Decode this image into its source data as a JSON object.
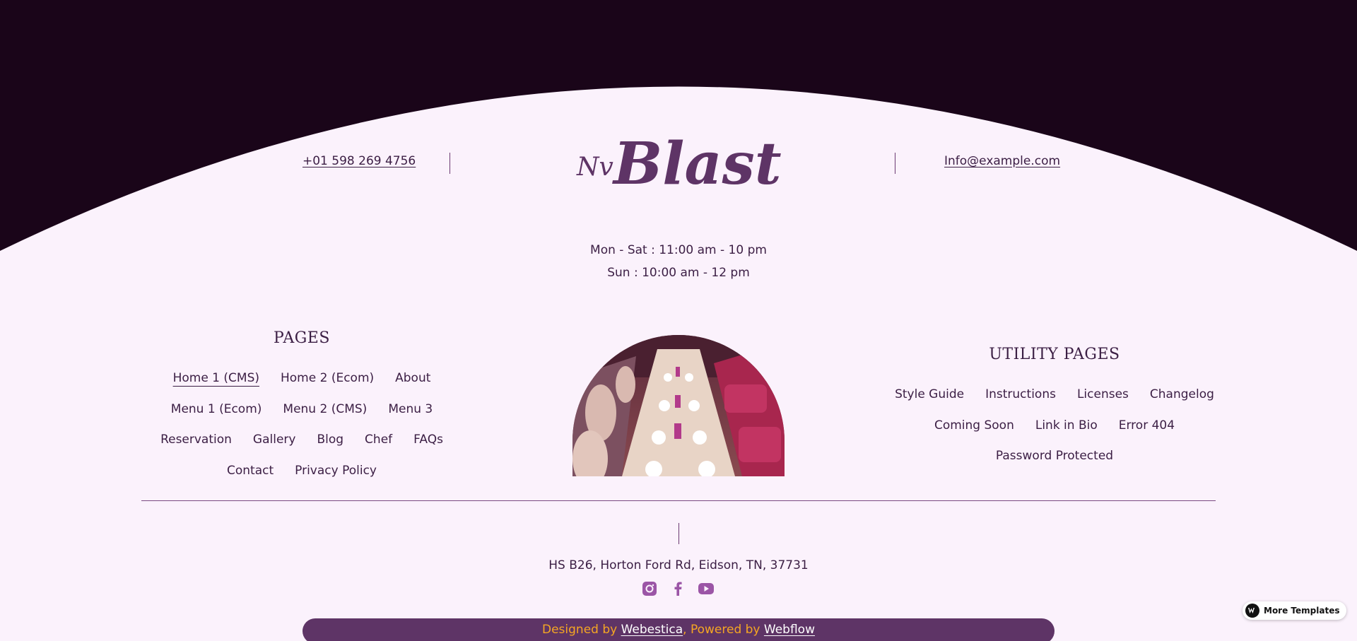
{
  "header": {
    "phone": "+01 598 269 4756",
    "email": "Info@example.com",
    "logo_small": "Nv",
    "logo_text": "Blast"
  },
  "hours": {
    "weekdays": "Mon - Sat : 11:00 am - 10 pm",
    "sunday": "Sun : 10:00 am - 12 pm"
  },
  "pages": {
    "title": "PAGES",
    "rows": [
      [
        "Home 1 (CMS)",
        "Home 2 (Ecom)",
        "About"
      ],
      [
        "Menu 1 (Ecom)",
        "Menu 2 (CMS)",
        "Menu 3"
      ],
      [
        "Reservation",
        "Gallery",
        "Blog",
        "Chef",
        "FAQs"
      ],
      [
        "Contact",
        "Privacy Policy"
      ]
    ]
  },
  "utility": {
    "title": "UTILITY PAGES",
    "rows": [
      [
        "Style Guide",
        "Instructions",
        "Licenses",
        "Changelog"
      ],
      [
        "Coming Soon",
        "Link in Bio",
        "Error 404"
      ],
      [
        "Password Protected"
      ]
    ]
  },
  "footer": {
    "address": "HS B26, Horton Ford Rd, Eidson, TN, 37731",
    "socials": [
      "instagram-icon",
      "facebook-icon",
      "youtube-icon"
    ],
    "designed_by": "Designed by ",
    "webestica": "Webestica",
    "powered_by": ", Powered by ",
    "webflow": "Webflow"
  },
  "badge": {
    "label": "More Templates"
  },
  "colors": {
    "dark_bg": "#1a0519",
    "page_bg": "#fbf2fc",
    "accent": "#5e3466",
    "credit_text": "#f5a623"
  }
}
